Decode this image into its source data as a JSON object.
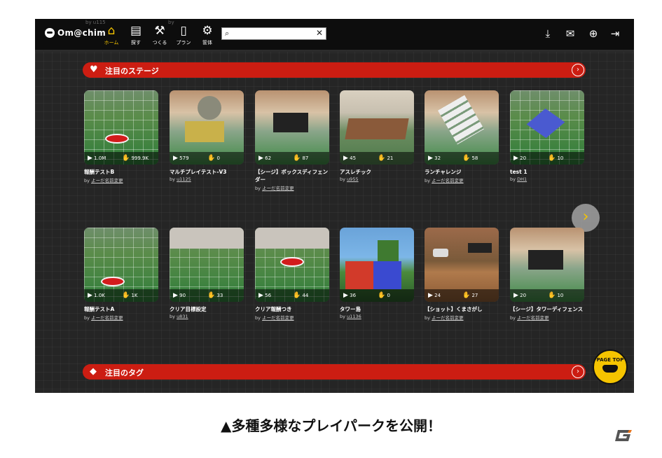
{
  "app": {
    "name": "Om@chim"
  },
  "ghost_text": [
    "by u115",
    "by"
  ],
  "nav": [
    {
      "label": "ホーム",
      "icon": "house-icon",
      "active": true
    },
    {
      "label": "探す",
      "icon": "map-icon",
      "active": false
    },
    {
      "label": "つくる",
      "icon": "wrench-icon",
      "active": false
    },
    {
      "label": "プラン",
      "icon": "clipboard-icon",
      "active": false
    },
    {
      "label": "筐体",
      "icon": "gears-icon",
      "active": false
    }
  ],
  "search": {
    "value": "",
    "placeholder": ""
  },
  "right_icons": [
    "download-icon",
    "ticket-icon",
    "globe-icon",
    "logout-icon"
  ],
  "sections": {
    "featured": {
      "title": "注目のステージ",
      "icon": "heart-icon"
    },
    "tags": {
      "title": "注目のタグ",
      "icon": "tag-icon"
    }
  },
  "row1": [
    {
      "title": "報酬テストB",
      "by": "by",
      "user": "よーだ名前変更",
      "plays": "1.0M",
      "likes": "999.9K"
    },
    {
      "title": "マルチプレイテスト-V3",
      "by": "by",
      "user": "u1125",
      "plays": "579",
      "likes": "0"
    },
    {
      "title": "【シージ】ボックスディフェンダー",
      "by": "by",
      "user": "よーだ名前変更",
      "plays": "62",
      "likes": "87"
    },
    {
      "title": "アスレチック",
      "by": "by",
      "user": "u955",
      "plays": "45",
      "likes": "21"
    },
    {
      "title": "ランチャレンジ",
      "by": "by",
      "user": "よーだ名前変更",
      "plays": "32",
      "likes": "58"
    },
    {
      "title": "test 1",
      "by": "by",
      "user": "DH1",
      "plays": "20",
      "likes": "10"
    }
  ],
  "row2": [
    {
      "title": "報酬テストA",
      "by": "by",
      "user": "よーだ名前変更",
      "plays": "1.0K",
      "likes": "1K"
    },
    {
      "title": "クリア目標設定",
      "by": "by",
      "user": "u831",
      "plays": "90",
      "likes": "33"
    },
    {
      "title": "クリア報酬つき",
      "by": "by",
      "user": "よーだ名前変更",
      "plays": "56",
      "likes": "44"
    },
    {
      "title": "タワー島",
      "by": "by",
      "user": "u1136",
      "plays": "36",
      "likes": "0"
    },
    {
      "title": "【ショット】くまさがし",
      "by": "by",
      "user": "よーだ名前変更",
      "plays": "24",
      "likes": "27"
    },
    {
      "title": "【シージ】タワーディフェンス",
      "by": "by",
      "user": "よーだ名前変更",
      "plays": "20",
      "likes": "10"
    }
  ],
  "page_top": {
    "label": "PAGE TOP"
  },
  "caption": "▲多種多様なプレイパークを公開！",
  "colors": {
    "banner": "#cc1d12",
    "accent": "#f5c400",
    "topbar": "#0d0d0d",
    "bg": "#252525"
  }
}
